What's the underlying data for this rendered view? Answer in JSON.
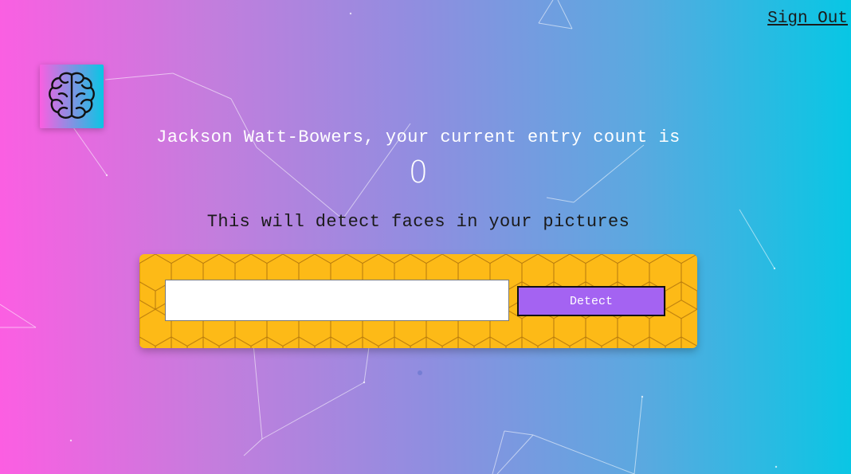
{
  "nav": {
    "sign_out_label": "Sign Out"
  },
  "logo": {
    "icon": "brain-icon"
  },
  "rank": {
    "greeting": "Jackson Watt-Bowers, your current entry count is",
    "count": "0"
  },
  "form": {
    "description": "This will detect faces in your pictures",
    "input_value": "",
    "detect_label": "Detect"
  },
  "colors": {
    "gradient_start": "#fc5ee2",
    "gradient_end": "#07c7e4",
    "panel": "#fdba17",
    "button": "#a463f2"
  }
}
